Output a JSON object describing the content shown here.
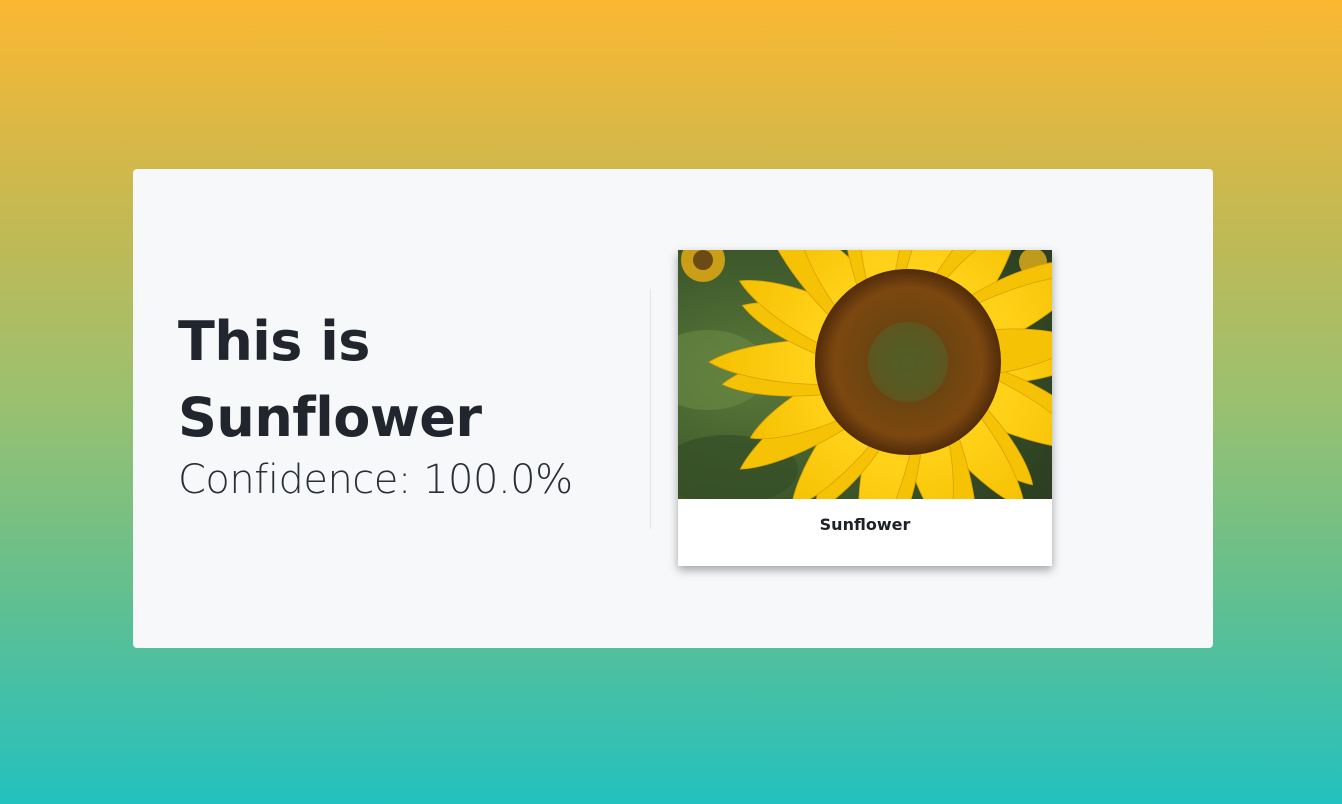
{
  "result": {
    "title_line1": "This is",
    "title_line2": "Sunflower",
    "confidence": "Confidence: 100.0%"
  },
  "image_card": {
    "caption": "Sunflower",
    "image_subject": "sunflower-photo"
  },
  "colors": {
    "background_top": "#fbb731",
    "background_bottom": "#23c1bf",
    "card": "#f7f8fa",
    "text": "#21252d",
    "petal": "#f8c90c",
    "seed_center": "#8a4b12"
  }
}
